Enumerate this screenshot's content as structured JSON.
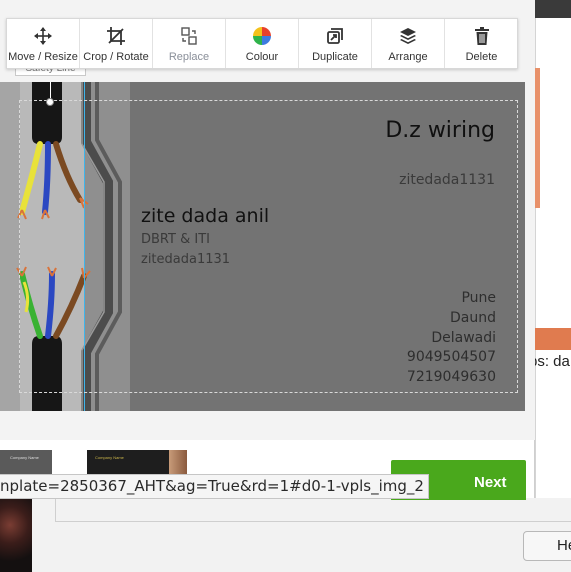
{
  "toolbar": {
    "move_label": "Move / Resize",
    "crop_label": "Crop / Rotate",
    "replace_label": "Replace",
    "colour_label": "Colour",
    "duplicate_label": "Duplicate",
    "arrange_label": "Arrange",
    "delete_label": "Delete",
    "icons": [
      "move-icon",
      "crop-rotate-icon",
      "replace-icon",
      "colour-wheel-icon",
      "duplicate-icon",
      "layers-icon",
      "trash-icon"
    ]
  },
  "safety_tab": {
    "label": "Safety Line"
  },
  "card": {
    "company_name": "D.z wiring",
    "company_tag": "zitedada1131",
    "person_name": "zite dada anil",
    "person_qualification": "DBRT & ITI",
    "person_id": "zitedada1131",
    "address_lines": [
      "Pune",
      "Daund",
      "Delawadi",
      "9049504507",
      "7219049630"
    ]
  },
  "thumbnails": {
    "thumb1_text": "Company Name",
    "thumb2_text": "Company Name"
  },
  "next_button": {
    "label": "Next"
  },
  "status_bar": {
    "url": "nplate=2850367_AHT&ag=True&rd=1#d0-1-vpls_img_2"
  },
  "background": {
    "partial_text": "ps: da",
    "help_button_label": "He"
  },
  "colors": {
    "card_background": "#737373",
    "next_button": "#4aa81c",
    "guide_line": "#3fb4ea",
    "accent_orange": "#e07b4f"
  }
}
